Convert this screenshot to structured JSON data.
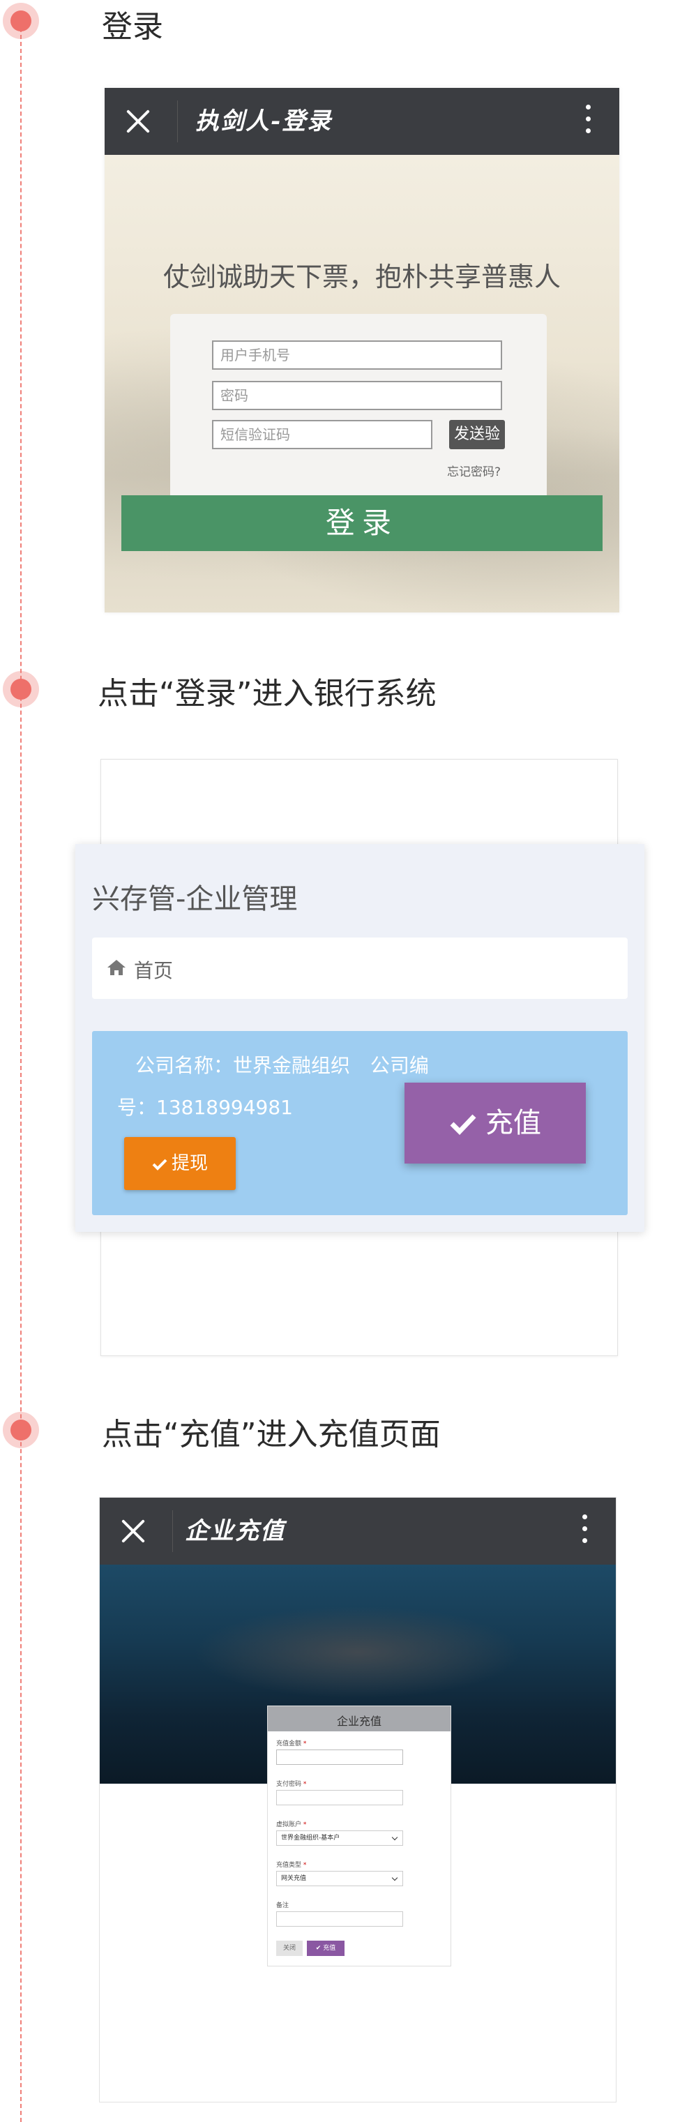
{
  "steps": [
    {
      "title": "登录"
    },
    {
      "title": "点击“登录”进入银行系统"
    },
    {
      "title": "点击“充值”进入充值页面"
    }
  ],
  "login_screen": {
    "window_title": "执剑人-登录",
    "slogan": "仗剑诚助天下票，抱朴共享普惠人",
    "phone_placeholder": "用户手机号",
    "password_placeholder": "密码",
    "sms_placeholder": "短信验证码",
    "send_code_label": "发送验",
    "forgot_password": "忘记密码?",
    "login_button": "登录",
    "login_button_color": "#4a9466"
  },
  "management": {
    "title": "兴存管-企业管理",
    "breadcrumb_home": "首页",
    "company_line": "公司名称：世界金融组织 公司编",
    "company_number_line": "号：13818994981",
    "withdraw_label": "提现",
    "recharge_label": "充值",
    "withdraw_color": "#ee8012",
    "recharge_color": "#9561a8",
    "panel_color": "#9ecdf1"
  },
  "recharge_screen": {
    "window_title": "企业充值",
    "form_title": "企业充值",
    "amount_label": "充值金额",
    "payment_password_label": "支付密码",
    "virtual_account_label": "虚拟账户",
    "virtual_account_value": "世界金融组织-基本户",
    "recharge_type_label": "充值类型",
    "recharge_type_value": "网关充值",
    "remark_label": "备注",
    "required_mark": "*",
    "close_button": "关闭",
    "confirm_button": "充值"
  },
  "icons": {
    "close": "close-icon",
    "menu": "more-vertical-icon",
    "home": "home-icon",
    "check": "check-icon"
  },
  "colors": {
    "timeline": "#ee706a",
    "toolbar": "#3b3d41"
  }
}
